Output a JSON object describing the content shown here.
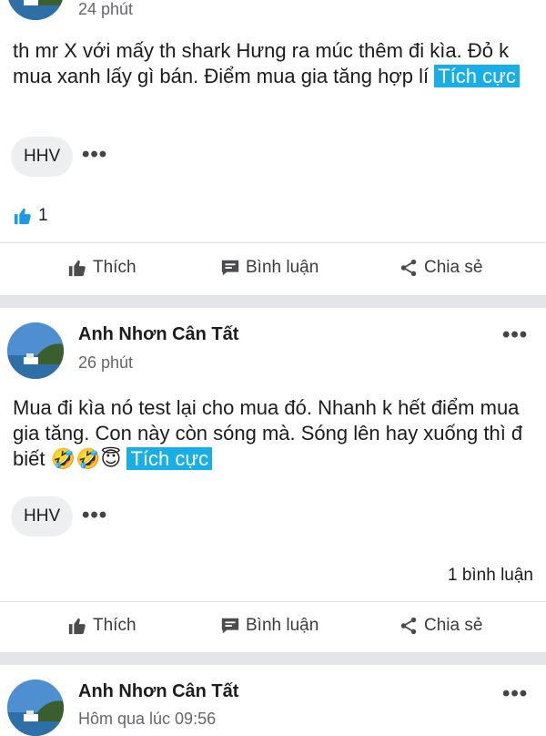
{
  "posts": [
    {
      "time": "24 phút",
      "text": "th mr X với mấy th shark Hưng ra múc thêm đi kìa. Đỏ k mua xanh lấy gì bán. Điểm mua gia tăng hợp lí",
      "tag": "Tích cực",
      "chip": "HHV",
      "reactions_count": "1",
      "actions": {
        "like": "Thích",
        "comment": "Bình luận",
        "share": "Chia sẻ"
      }
    },
    {
      "author": "Anh Nhơn Cân Tất",
      "time": "26 phút",
      "text": "Mua đi kìa nó test lại cho mua đó. Nhanh k hết điểm mua gia tăng. Con này còn sóng mà. Sóng lên hay xuống thì đ biết",
      "emojis": "🤣🤣😇",
      "tag": "Tích cực",
      "chip": "HHV",
      "comments_count": "1 bình luận",
      "actions": {
        "like": "Thích",
        "comment": "Bình luận",
        "share": "Chia sẻ"
      }
    },
    {
      "author": "Anh Nhơn Cân Tất",
      "time": "Hôm qua lúc 09:56"
    }
  ],
  "colors": {
    "tag_bg": "#18aee8",
    "like_blue": "#1877f2",
    "separator": "#e4e5e8"
  },
  "icons": {
    "like": "thumbs-up-icon",
    "comment": "comment-icon",
    "share": "share-icon",
    "more": "more-dots-icon"
  }
}
